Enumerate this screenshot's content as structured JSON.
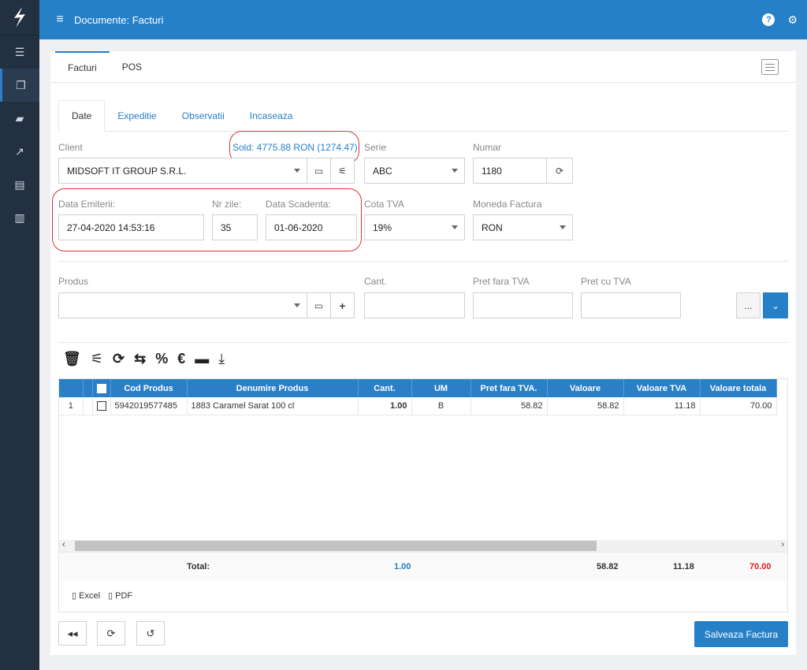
{
  "header": {
    "title": "Documente: Facturi"
  },
  "main_tabs": [
    "Facturi",
    "POS"
  ],
  "sub_tabs": [
    "Date",
    "Expeditie",
    "Observatii",
    "Incaseaza"
  ],
  "form": {
    "client_label": "Client",
    "client_value": "MIDSOFT IT GROUP S.R.L.",
    "sold_text": "Sold: 4775.88 RON (1274.47)",
    "serie_label": "Serie",
    "serie_value": "ABC",
    "numar_label": "Numar",
    "numar_value": "1180",
    "data_emiterii_label": "Data Emiterii:",
    "data_emiterii_value": "27-04-2020 14:53:16",
    "nr_zile_label": "Nr zile:",
    "nr_zile_value": "35",
    "data_scadenta_label": "Data Scadenta:",
    "data_scadenta_value": "01-06-2020",
    "cota_tva_label": "Cota TVA",
    "cota_tva_value": "19%",
    "moneda_label": "Moneda Factura",
    "moneda_value": "RON",
    "produs_label": "Produs",
    "cant_label": "Cant.",
    "pret_fara_label": "Pret fara TVA",
    "pret_cu_label": "Pret cu TVA",
    "more_label": "..."
  },
  "table": {
    "headers": [
      "Cod Produs",
      "Denumire Produs",
      "Cant.",
      "UM",
      "Pret fara TVA.",
      "Valoare",
      "Valoare TVA",
      "Valoare totala"
    ],
    "rows": [
      {
        "idx": "1",
        "cod": "5942019577485",
        "denumire": "1883 Caramel Sarat 100 cl",
        "cant": "1.00",
        "um": "B",
        "pret": "58.82",
        "valoare": "58.82",
        "tva": "11.18",
        "total": "70.00"
      }
    ],
    "totals": {
      "label": "Total:",
      "cant": "1.00",
      "valoare": "58.82",
      "tva": "11.18",
      "total": "70.00"
    }
  },
  "export": {
    "excel": "Excel",
    "pdf": "PDF"
  },
  "footer": {
    "save_label": "Salveaza Factura"
  }
}
